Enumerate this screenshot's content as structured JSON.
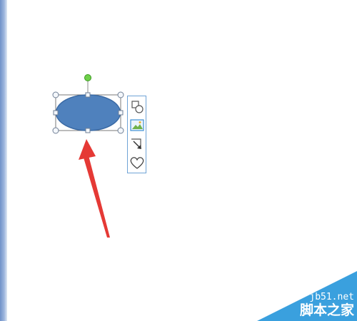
{
  "canvas": {
    "background": "#ffffff",
    "edge_color": "#6f92c8"
  },
  "shape": {
    "type": "ellipse",
    "fill": "#4f81bd",
    "stroke": "#3a6aa5",
    "selected": true
  },
  "layout_options": {
    "items": [
      {
        "icon": "wrap-shape-icon"
      },
      {
        "icon": "picture-icon"
      },
      {
        "icon": "arrow-resize-icon"
      },
      {
        "icon": "heart-icon"
      }
    ]
  },
  "annotation": {
    "arrow_color": "#e53935"
  },
  "watermark": {
    "url": "jb51.net",
    "name": "脚本之家",
    "color": "#3aa0de"
  }
}
